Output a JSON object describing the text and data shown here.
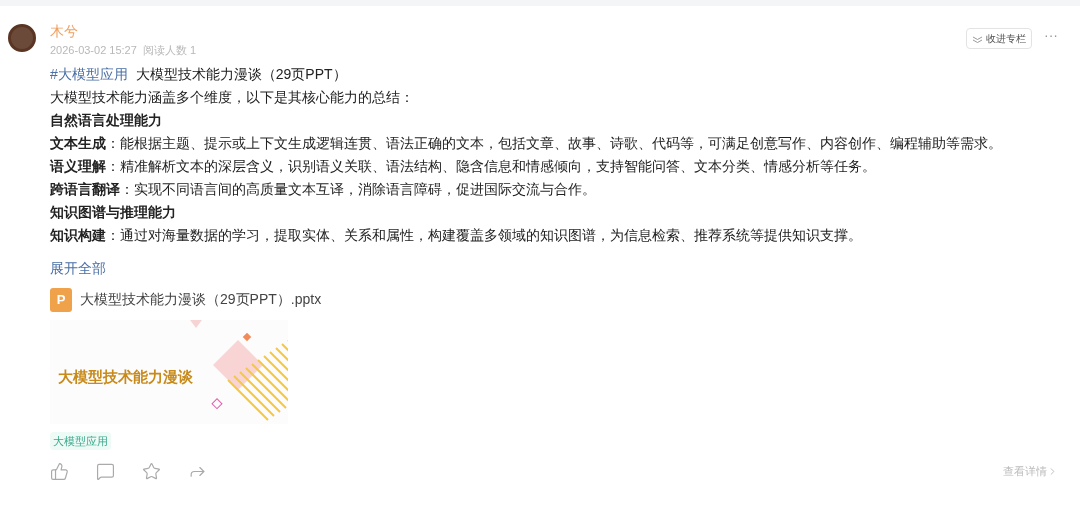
{
  "author": {
    "name": "木兮",
    "date": "2026-03-02 15:27",
    "readers": "阅读人数 1"
  },
  "follow_button": "收进专栏",
  "more_button": "···",
  "post": {
    "topic": "#大模型应用",
    "title": "大模型技术能力漫谈（29页PPT）",
    "lines": [
      "大模型技术能力涵盖多个维度，以下是其核心能力的总结：",
      "**自然语言处理能力**",
      "**文本生成**：能根据主题、提示或上下文生成逻辑连贯、语法正确的文本，包括文章、故事、诗歌、代码等，可满足创意写作、内容创作、编程辅助等需求。",
      "**语义理解**：精准解析文本的深层含义，识别语义关联、语法结构、隐含信息和情感倾向，支持智能问答、文本分类、情感分析等任务。",
      "**跨语言翻译**：实现不同语言间的高质量文本互译，消除语言障碍，促进国际交流与合作。",
      "**知识图谱与推理能力**",
      "**知识构建**：通过对海量数据的学习，提取实体、关系和属性，构建覆盖多领域的知识图谱，为信息检索、推荐系统等提供知识支撑。"
    ],
    "expand_link": "展开全部"
  },
  "attachment": {
    "file_name": "大模型技术能力漫谈（29页PPT）.pptx",
    "file_icon": "P",
    "cover_title": "大模型技术能力漫谈"
  },
  "tags": [
    "大模型应用"
  ],
  "detail_link": "查看详情"
}
